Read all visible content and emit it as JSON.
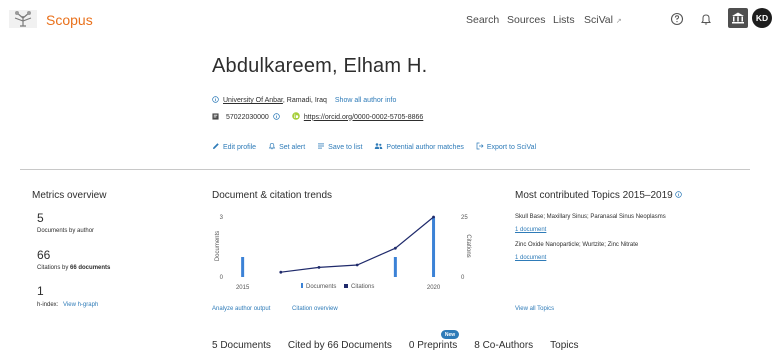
{
  "header": {
    "brand": "Scopus",
    "nav": [
      "Search",
      "Sources",
      "Lists"
    ],
    "scival": "SciVal",
    "scival_arrow": "↗",
    "avatar_initials": "KD"
  },
  "profile": {
    "name": "Abdulkareem, Elham H.",
    "affiliation": "University Of Anbar",
    "location": ", Ramadi, Iraq",
    "show_all_info": "Show all author info",
    "author_id": "57022030000",
    "orcid": "https://orcid.org/0000-0002-5705-8866",
    "actions": [
      "Edit profile",
      "Set alert",
      "Save to list",
      "Potential author matches",
      "Export to SciVal"
    ]
  },
  "metrics": {
    "title": "Metrics overview",
    "documents": "5",
    "documents_label": "Documents by author",
    "citations": "66",
    "citations_label_pre": "Citations by ",
    "citations_label_bold": "66 documents",
    "h_index": "1",
    "h_index_label": "h-index:",
    "h_graph_link": "View h-graph"
  },
  "trends": {
    "title": "Document & citation trends",
    "analyze_link": "Analyze author output",
    "citation_overview_link": "Citation overview"
  },
  "chart_data": {
    "type": "bar",
    "x": [
      2015,
      2016,
      2017,
      2018,
      2019,
      2020
    ],
    "x_tick_labels": [
      "2015",
      "2020"
    ],
    "xlim": [
      2014.8,
      2020.3
    ],
    "series": [
      {
        "name": "Documents",
        "kind": "bar",
        "axis": "left",
        "values": [
          1,
          null,
          null,
          null,
          1,
          3
        ],
        "color": "#3b82d6"
      },
      {
        "name": "Citations",
        "kind": "line",
        "axis": "right",
        "values": [
          null,
          2,
          4,
          5,
          12,
          25
        ],
        "color": "#1f2a6b"
      }
    ],
    "ylabel_left": "Documents",
    "ylabel_right": "Citations",
    "ylim_left": [
      0,
      3
    ],
    "ylim_right": [
      0,
      25
    ],
    "left_ticks": [
      "3",
      "0"
    ],
    "right_ticks": [
      "25",
      "0"
    ],
    "legend_position": "bottom"
  },
  "topics": {
    "title": "Most contributed Topics 2015–2019",
    "items": [
      {
        "name": "Skull Base; Maxillary Sinus; Paranasal Sinus Neoplasms",
        "count": "1 document"
      },
      {
        "name": "Zinc Oxide Nanoparticle; Wurtzite; Zinc Nitrate",
        "count": "1 document"
      }
    ],
    "view_all": "View all Topics"
  },
  "tabs": {
    "items": [
      "5 Documents",
      "Cited by 66 Documents",
      "0 Preprints",
      "8 Co-Authors",
      "Topics"
    ],
    "new_badge": "New"
  },
  "colors": {
    "brand": "#e9711c",
    "link": "#2e7bb8",
    "bar": "#3b82d6",
    "line": "#1f2a6b"
  }
}
